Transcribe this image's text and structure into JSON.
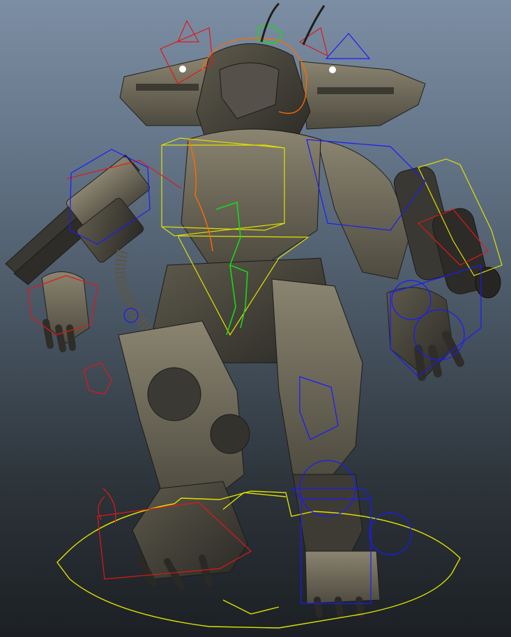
{
  "viewport": {
    "background_top": "#7c8ea3",
    "background_bottom": "#1c2024"
  },
  "model": {
    "armor_color": "#6b6553",
    "armor_highlight": "#8a8470",
    "armor_shadow": "#2e2c27",
    "joint_color": "#1e1e1e"
  },
  "rig_controls": {
    "ik_handle_color": "#1a1aff",
    "fk_control_color": "#e01818",
    "root_control_color": "#e0e000",
    "spine_curve_color": "#18d818",
    "head_curve_color": "#ff6a00"
  }
}
